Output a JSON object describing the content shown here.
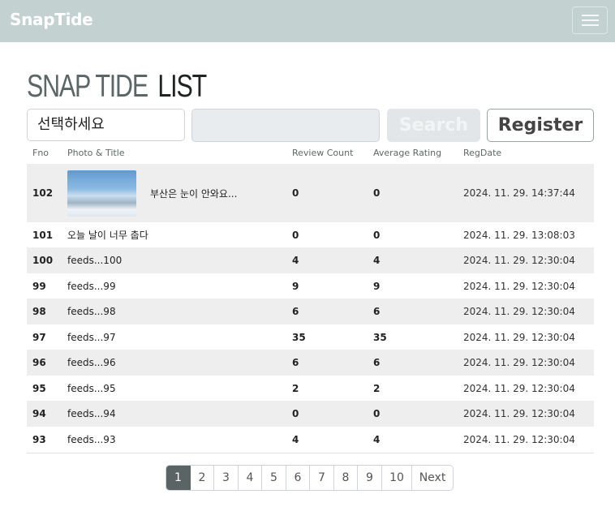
{
  "navbar": {
    "brand": "SnapTide"
  },
  "heading": {
    "part1": "SNAP TIDE",
    "part2": "LIST"
  },
  "search": {
    "type_selected": "선택하세요",
    "keyword_value": "",
    "search_label": "Search",
    "register_label": "Register"
  },
  "table": {
    "headers": [
      "Fno",
      "Photo & Title",
      "Review Count",
      "Average Rating",
      "RegDate"
    ],
    "rows": [
      {
        "fno": "102",
        "title": "부산은 눈이 안와요...",
        "has_photo": true,
        "review_count": "0",
        "avg_rating": "0",
        "regdate": "2024. 11. 29. 14:37:44"
      },
      {
        "fno": "101",
        "title": "오늘 날이 너무 춥다",
        "has_photo": false,
        "review_count": "0",
        "avg_rating": "0",
        "regdate": "2024. 11. 29. 13:08:03"
      },
      {
        "fno": "100",
        "title": "feeds...100",
        "has_photo": false,
        "review_count": "4",
        "avg_rating": "4",
        "regdate": "2024. 11. 29. 12:30:04"
      },
      {
        "fno": "99",
        "title": "feeds...99",
        "has_photo": false,
        "review_count": "9",
        "avg_rating": "9",
        "regdate": "2024. 11. 29. 12:30:04"
      },
      {
        "fno": "98",
        "title": "feeds...98",
        "has_photo": false,
        "review_count": "6",
        "avg_rating": "6",
        "regdate": "2024. 11. 29. 12:30:04"
      },
      {
        "fno": "97",
        "title": "feeds...97",
        "has_photo": false,
        "review_count": "35",
        "avg_rating": "35",
        "regdate": "2024. 11. 29. 12:30:04"
      },
      {
        "fno": "96",
        "title": "feeds...96",
        "has_photo": false,
        "review_count": "6",
        "avg_rating": "6",
        "regdate": "2024. 11. 29. 12:30:04"
      },
      {
        "fno": "95",
        "title": "feeds...95",
        "has_photo": false,
        "review_count": "2",
        "avg_rating": "2",
        "regdate": "2024. 11. 29. 12:30:04"
      },
      {
        "fno": "94",
        "title": "feeds...94",
        "has_photo": false,
        "review_count": "0",
        "avg_rating": "0",
        "regdate": "2024. 11. 29. 12:30:04"
      },
      {
        "fno": "93",
        "title": "feeds...93",
        "has_photo": false,
        "review_count": "4",
        "avg_rating": "4",
        "regdate": "2024. 11. 29. 12:30:04"
      }
    ]
  },
  "pagination": {
    "pages": [
      "1",
      "2",
      "3",
      "4",
      "5",
      "6",
      "7",
      "8",
      "9",
      "10"
    ],
    "active": "1",
    "next_label": "Next"
  },
  "colors": {
    "navbar_bg": "#c3d1d1",
    "active_page_bg": "#5b6464",
    "stripe_bg": "#eeeeee"
  }
}
